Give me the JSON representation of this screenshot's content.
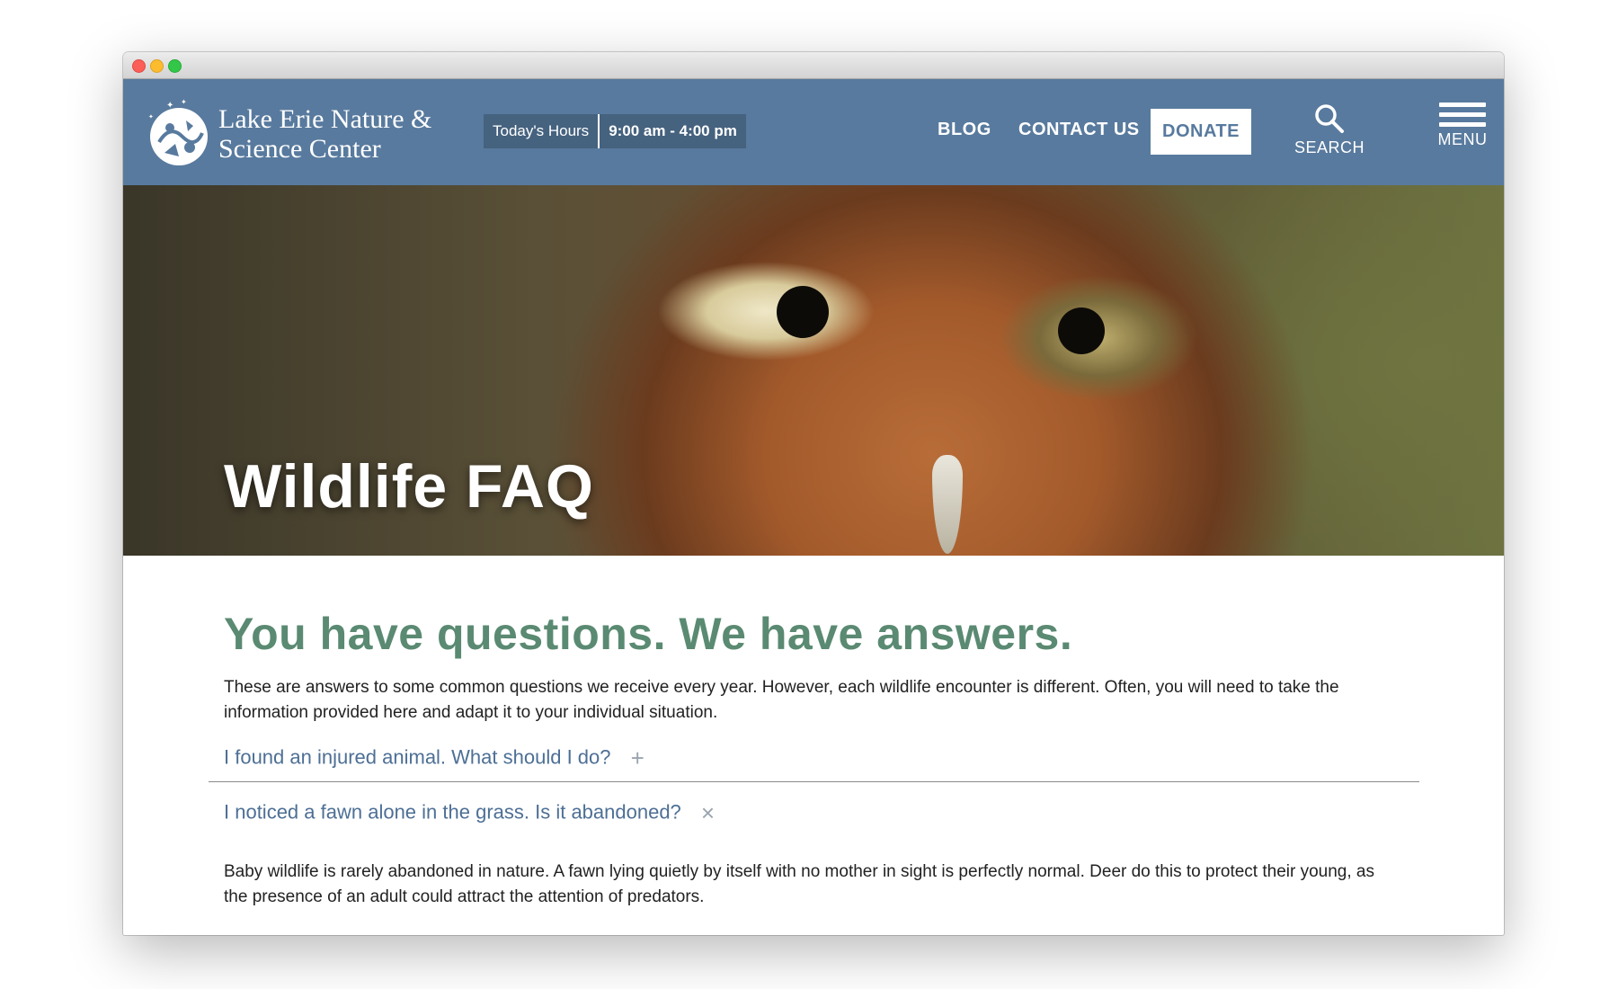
{
  "site": {
    "logo_line1": "Lake Erie Nature &",
    "logo_line2": "Science Center"
  },
  "hours": {
    "label": "Today's Hours",
    "value": "9:00 am - 4:00 pm"
  },
  "nav": {
    "blog": "BLOG",
    "contact": "CONTACT US",
    "donate": "DONATE",
    "search": "SEARCH",
    "menu": "MENU"
  },
  "hero": {
    "title": "Wildlife FAQ"
  },
  "main": {
    "headline": "You have questions. We have answers.",
    "intro": "These are answers to some common questions we receive every year. However, each wildlife encounter is different. Often, you will need to take the information provided here and adapt it to your individual situation.",
    "faqs": [
      {
        "question": "I found an injured animal. What should I do?",
        "toggle": "+"
      },
      {
        "question": "I noticed a fawn alone in the grass. Is it abandoned?",
        "toggle": "×",
        "answer": "Baby wildlife is rarely abandoned in nature. A fawn lying quietly by itself with no mother in sight is perfectly normal. Deer do this to protect their young, as the presence of an adult could attract the attention of predators."
      }
    ]
  },
  "colors": {
    "header_bg": "#587a9e",
    "headline": "#5a8a72",
    "faq_link": "#4d6f95"
  }
}
